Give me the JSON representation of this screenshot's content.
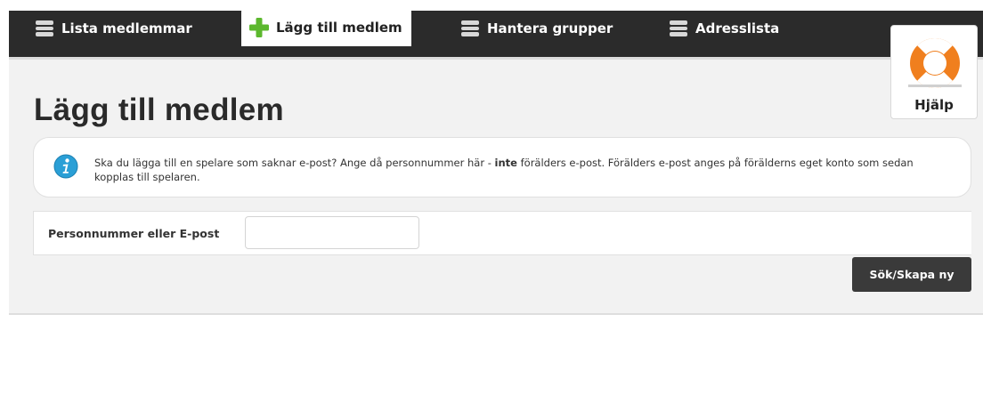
{
  "nav": {
    "tabs": [
      {
        "label": "Lista medlemmar",
        "icon": "list-icon",
        "active": false
      },
      {
        "label": "Lägg till medlem",
        "icon": "plus-icon",
        "active": true
      },
      {
        "label": "Hantera grupper",
        "icon": "list-icon",
        "active": false
      },
      {
        "label": "Adresslista",
        "icon": "list-icon",
        "active": false
      }
    ]
  },
  "help": {
    "label": "Hjälp",
    "icon": "lifebuoy-icon"
  },
  "page": {
    "title": "Lägg till medlem"
  },
  "info": {
    "icon": "info-icon",
    "text_before": "Ska du lägga till en spelare som saknar e-post? Ange då personnummer här - ",
    "emphasis": "inte",
    "text_after": " förälders e-post. Förälders e-post anges på förälderns eget konto som sedan kopplas till spelaren."
  },
  "form": {
    "field_label": "Personnummer eller E-post",
    "field_value": "",
    "submit_label": "Sök/Skapa ny"
  },
  "colors": {
    "topbar": "#2b2b2b",
    "accent_green": "#5cb82e",
    "lifebuoy_orange": "#f07f1e",
    "info_blue": "#2a9fd6",
    "button_dark": "#3a3a3a"
  }
}
